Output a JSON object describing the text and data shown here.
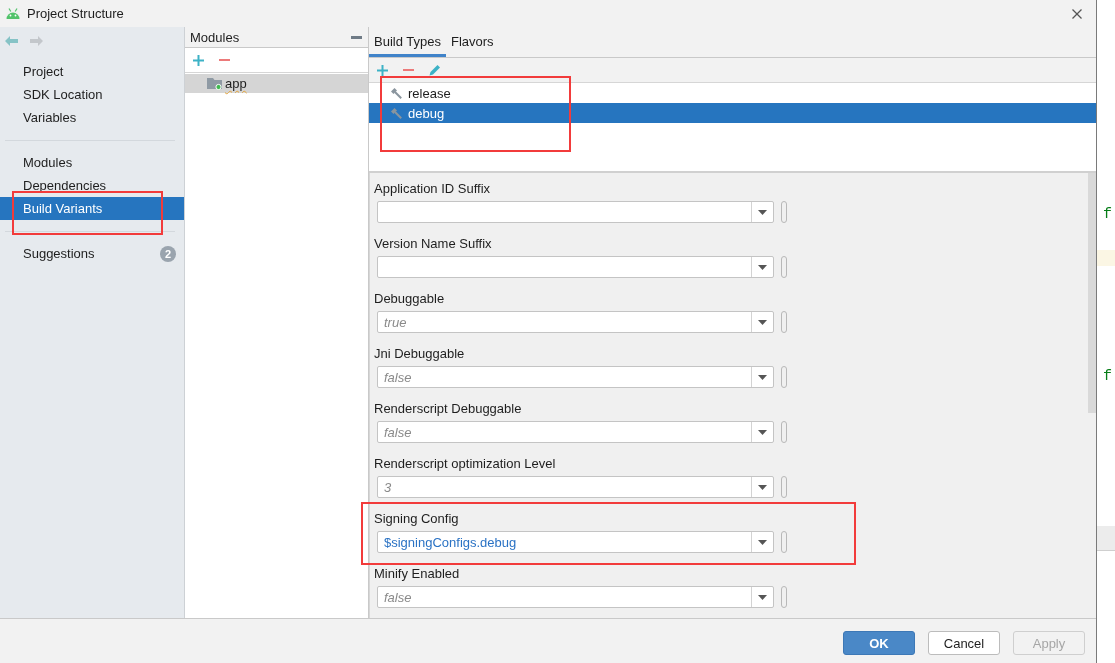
{
  "window": {
    "title": "Project Structure"
  },
  "history_buttons": [
    {
      "kind": "back",
      "disabled": false
    },
    {
      "kind": "forward",
      "disabled": true
    }
  ],
  "sidebar": {
    "groups": [
      {
        "items": [
          {
            "label": "Project",
            "selected": false,
            "highlighted": false
          },
          {
            "label": "SDK Location",
            "selected": false,
            "highlighted": false
          },
          {
            "label": "Variables",
            "selected": false,
            "highlighted": false
          }
        ]
      },
      {
        "items": [
          {
            "label": "Modules",
            "selected": false,
            "highlighted": false
          },
          {
            "label": "Dependencies",
            "selected": false,
            "highlighted": false
          },
          {
            "label": "Build Variants",
            "selected": true,
            "highlighted": true
          }
        ]
      },
      {
        "items": [
          {
            "label": "Suggestions",
            "selected": false,
            "highlighted": false,
            "badge": "2"
          }
        ]
      }
    ]
  },
  "modules": {
    "title": "Modules",
    "items": [
      {
        "label": "app",
        "selected": true
      }
    ]
  },
  "tabs": [
    {
      "label": "Build Types",
      "selected": true
    },
    {
      "label": "Flavors",
      "selected": false
    }
  ],
  "build_types": {
    "highlighted": true,
    "items": [
      {
        "label": "release",
        "selected": false
      },
      {
        "label": "debug",
        "selected": true
      }
    ]
  },
  "fields": [
    {
      "label": "Application ID Suffix",
      "highlighted": false
    },
    {
      "label": "Version Name Suffix",
      "highlighted": false
    },
    {
      "label": "Debuggable",
      "placeholder": "true",
      "highlighted": false
    },
    {
      "label": "Jni Debuggable",
      "placeholder": "false",
      "highlighted": false
    },
    {
      "label": "Renderscript Debuggable",
      "placeholder": "false",
      "highlighted": false
    },
    {
      "label": "Renderscript optimization Level",
      "placeholder": "3",
      "highlighted": false
    },
    {
      "label": "Signing Config",
      "value": "$signingConfigs.debug",
      "highlighted": true
    },
    {
      "label": "Minify Enabled",
      "placeholder": "false",
      "highlighted": false
    }
  ],
  "buttons": [
    {
      "label": "OK",
      "kind": "primary",
      "disabled": false
    },
    {
      "label": "Cancel",
      "kind": "normal",
      "disabled": false
    },
    {
      "label": "Apply",
      "kind": "normal",
      "disabled": true
    }
  ],
  "editor_background": {
    "code_fragments": [
      "f",
      "f"
    ]
  }
}
